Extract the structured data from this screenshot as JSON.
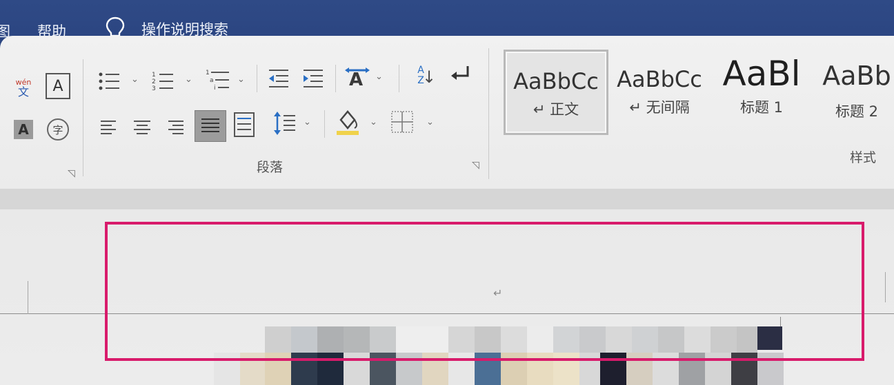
{
  "menu": {
    "view_partial": "图",
    "help": "帮助",
    "tell_me": "操作说明搜索"
  },
  "ribbon": {
    "font_group": {
      "phonetic_top": "wén",
      "phonetic_bottom": "文",
      "char_border": "A",
      "char_shading": "A",
      "enclose_char": "字"
    },
    "paragraph_group": {
      "label": "段落",
      "sort_glyph_top": "A",
      "sort_glyph_bottom": "Z"
    },
    "styles_group": {
      "label": "样式",
      "tiles": [
        {
          "preview": "AaBbCc",
          "name": "↵ 正文",
          "selected": true
        },
        {
          "preview": "AaBbCc",
          "name": "↵ 无间隔",
          "selected": false
        },
        {
          "preview": "AaBl",
          "name": "标题 1",
          "selected": false
        },
        {
          "preview": "AaBb",
          "name": "标题 2",
          "selected": false
        }
      ]
    }
  },
  "document": {
    "paragraph_mark": "↵",
    "highlight_color": "#d81b6b"
  },
  "colors": {
    "menubar": "#2c4682",
    "ribbon": "#eeeeee",
    "accent_red": "#d81b6b"
  }
}
